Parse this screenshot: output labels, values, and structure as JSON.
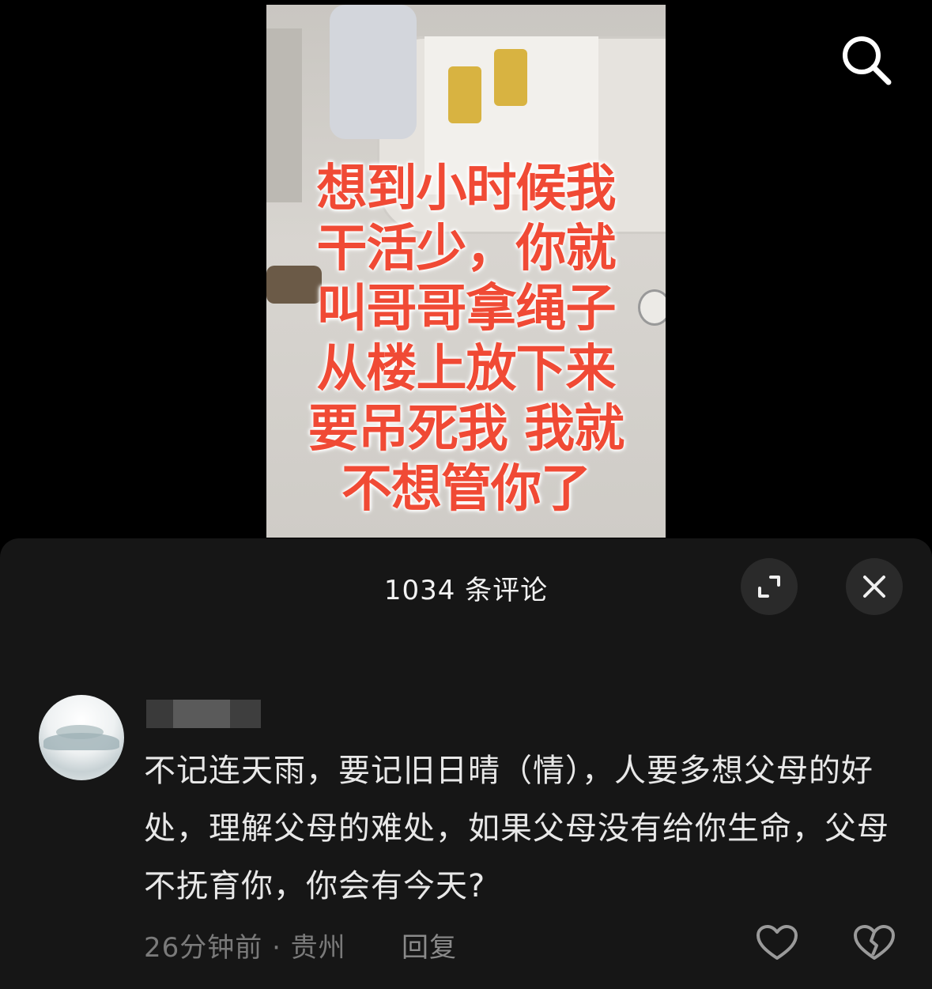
{
  "video": {
    "caption_lines": [
      "想到小时候我",
      "干活少，你就",
      "叫哥哥拿绳子",
      "从楼上放下来",
      "要吊死我 我就",
      "不想管你了"
    ],
    "caption_color": "#f04a35"
  },
  "toolbar": {
    "search_icon": "search-icon"
  },
  "comments_panel": {
    "title": "1034 条评论",
    "expand_icon": "expand-icon",
    "close_icon": "close-icon",
    "background": "#161616"
  },
  "comment": {
    "avatar_icon": "avatar-landscape",
    "text": "不记连天雨，要记旧日晴（情），人要多想父母的好处，理解父母的难处，如果父母没有给你生命，父母不抚育你，你会有今天?",
    "meta": "26分钟前 · 贵州",
    "reply_label": "回复",
    "like_icon": "heart-icon",
    "dislike_icon": "broken-heart-icon"
  }
}
